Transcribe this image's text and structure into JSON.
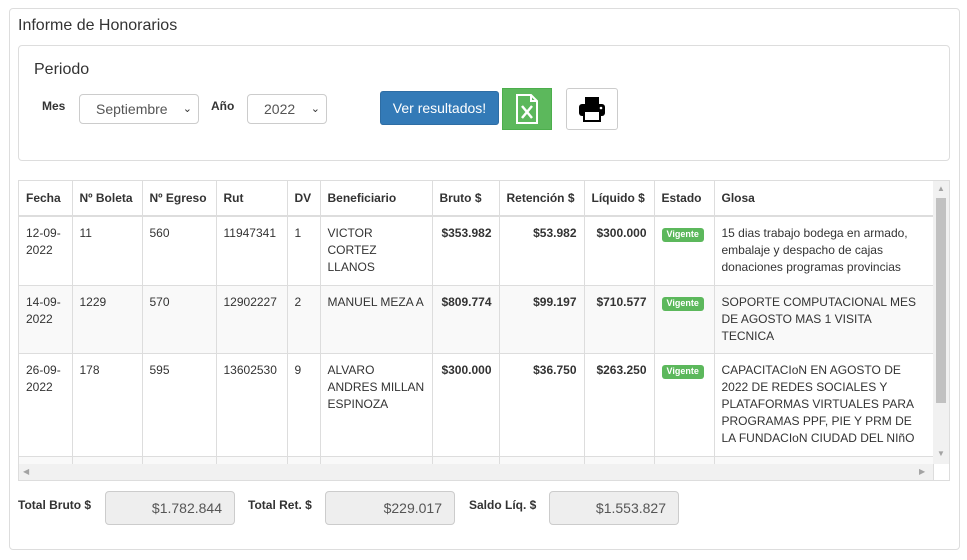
{
  "panel": {
    "title": "Informe de Honorarios"
  },
  "periodo": {
    "title": "Periodo",
    "mes_label": "Mes",
    "mes_value": "Septiembre",
    "ano_label": "Año",
    "ano_value": "2022",
    "ver_button": "Ver resultados!"
  },
  "table": {
    "headers": [
      "Fecha",
      "Nº Boleta",
      "Nº Egreso",
      "Rut",
      "DV",
      "Beneficiario",
      "Bruto $",
      "Retención $",
      "Líquido $",
      "Estado",
      "Glosa"
    ],
    "rows": [
      {
        "fecha": "12-09-2022",
        "boleta": "11",
        "egreso": "560",
        "rut": "11947341",
        "dv": "1",
        "beneficiario": "VICTOR CORTEZ LLANOS",
        "bruto": "$353.982",
        "retencion": "$53.982",
        "liquido": "$300.000",
        "estado": "Vigente",
        "glosa": "15 dias trabajo bodega en armado, embalaje y despacho de cajas donaciones programas provincias"
      },
      {
        "fecha": "14-09-2022",
        "boleta": "1229",
        "egreso": "570",
        "rut": "12902227",
        "dv": "2",
        "beneficiario": "MANUEL MEZA A",
        "bruto": "$809.774",
        "retencion": "$99.197",
        "liquido": "$710.577",
        "estado": "Vigente",
        "glosa": "SOPORTE COMPUTACIONAL MES DE AGOSTO MAS 1 VISITA TECNICA"
      },
      {
        "fecha": "26-09-2022",
        "boleta": "178",
        "egreso": "595",
        "rut": "13602530",
        "dv": "9",
        "beneficiario": "ALVARO ANDRES MILLAN ESPINOZA",
        "bruto": "$300.000",
        "retencion": "$36.750",
        "liquido": "$263.250",
        "estado": "Vigente",
        "glosa": "CAPACITACIoN EN AGOSTO DE 2022 DE REDES SOCIALES Y PLATAFORMAS VIRTUALES PARA PROGRAMAS PPF, PIE Y PRM DE LA FUNDACIoN CIUDAD DEL NIñO"
      }
    ]
  },
  "totals": {
    "bruto_label": "Total Bruto $",
    "bruto_value": "$1.782.844",
    "ret_label": "Total Ret. $",
    "ret_value": "$229.017",
    "saldo_label": "Saldo Líq. $",
    "saldo_value": "$1.553.827"
  },
  "colors": {
    "primary": "#337ab7",
    "success": "#5cb85c"
  },
  "icons": {
    "excel": "excel-icon",
    "print": "print-icon"
  }
}
